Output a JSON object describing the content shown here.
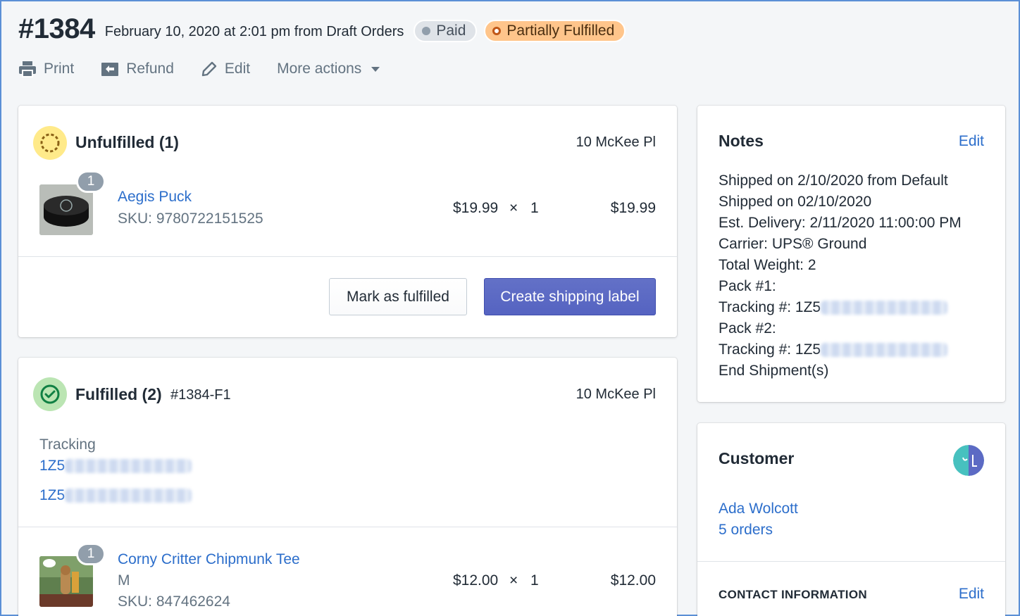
{
  "order": {
    "number": "#1384",
    "meta": "February 10, 2020 at 2:01 pm from Draft Orders",
    "badges": {
      "paid": "Paid",
      "partial": "Partially Fulfilled"
    },
    "actions": {
      "print": "Print",
      "refund": "Refund",
      "edit": "Edit",
      "more": "More actions"
    }
  },
  "unfulfilled": {
    "title": "Unfulfilled (1)",
    "address": "10 McKee Pl",
    "item": {
      "qty_badge": "1",
      "name": "Aegis Puck",
      "sku": "SKU: 9780722151525",
      "price": "$19.99",
      "times": "×",
      "qty": "1",
      "total": "$19.99"
    },
    "buttons": {
      "mark": "Mark as fulfilled",
      "create": "Create shipping label"
    }
  },
  "fulfilled": {
    "title": "Fulfilled (2)",
    "id": "#1384-F1",
    "address": "10 McKee Pl",
    "tracking_label": "Tracking",
    "tracking": [
      "1Z5",
      "1Z5"
    ],
    "item": {
      "qty_badge": "1",
      "name": "Corny Critter Chipmunk Tee",
      "variant": "M",
      "sku": "SKU: 847462624",
      "price": "$12.00",
      "times": "×",
      "qty": "1",
      "total": "$12.00"
    }
  },
  "notes": {
    "title": "Notes",
    "edit": "Edit",
    "lines": [
      "Shipped on 2/10/2020 from Default",
      "Shipped on 02/10/2020",
      "Est. Delivery: 2/11/2020 11:00:00 PM",
      "Carrier: UPS® Ground",
      "Total Weight: 2",
      "Pack #1:",
      "Tracking #: 1Z5",
      "Pack #2:",
      "Tracking #: 1Z5",
      "End Shipment(s)"
    ]
  },
  "customer": {
    "title": "Customer",
    "name": "Ada Wolcott",
    "orders": "5 orders",
    "contact_heading": "CONTACT INFORMATION",
    "contact_edit": "Edit"
  },
  "colors": {
    "accent": "#5c6ac4",
    "link": "#2c6ecb",
    "unfulfilled": "#ffea8a",
    "fulfilled": "#bbe5b3"
  }
}
